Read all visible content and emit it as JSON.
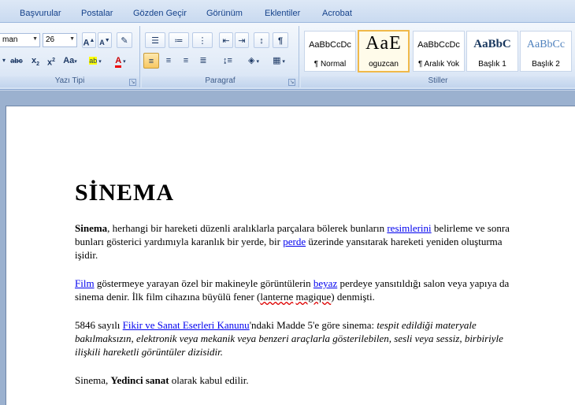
{
  "ribbon_tabs": [
    "Başvurular",
    "Postalar",
    "Gözden Geçir",
    "Görünüm",
    "Eklentiler",
    "Acrobat"
  ],
  "font_group": {
    "label": "Yazı Tipi",
    "font_name": "man",
    "font_size": "26",
    "grow_label": "A",
    "shrink_label": "A",
    "strike_label": "abc",
    "subscript_label": "x",
    "superscript_label": "x",
    "case_label": "Aa",
    "highlight_label": "ab",
    "font_color_label": "A"
  },
  "paragraph_group": {
    "label": "Paragraf"
  },
  "styles_group": {
    "label": "Stiller",
    "tiles": [
      {
        "sample": "AaBbCcDc",
        "name": "¶ Normal"
      },
      {
        "sample": "AaE",
        "name": "oguzcan"
      },
      {
        "sample": "AaBbCcDc",
        "name": "¶ Aralık Yok"
      },
      {
        "sample": "AaBbC",
        "name": "Başlık 1"
      },
      {
        "sample": "AaBbCc",
        "name": "Başlık 2"
      }
    ]
  },
  "document": {
    "title": "SİNEMA",
    "p1": {
      "bold": "Sinema",
      "t1": ", herhangi bir hareketi düzenli aralıklarla parçalara bölerek bunların ",
      "link1": "resimlerini",
      "t2": " belirleme ve sonra bunları gösterici yardımıyla karanlık bir yerde, bir ",
      "link2": "perde",
      "t3": " üzerinde yansıtarak hareketi yeniden oluşturma işidir."
    },
    "p2": {
      "link1": "Film",
      "t1": " göstermeye yarayan özel bir makineyle görüntülerin ",
      "link2": "beyaz",
      "t2": " perdeye yansıtıldığı salon veya yapıya da sinema denir. İlk film cihazına büyülü fener (",
      "squiggle1": "lanterne",
      "t3": " ",
      "squiggle2": "magique",
      "t4": ") denmişti."
    },
    "p3": {
      "t1": "5846 sayılı ",
      "link1": "Fikir ve Sanat Eserleri Kanunu",
      "t2": "'ndaki Madde 5'e göre sinema: ",
      "italic": "tespit edildiği materyale bakılmaksızın, elektronik veya mekanik veya benzeri araçlarla gösterilebilen, sesli veya sessiz, birbiriyle ilişkili hareketli görüntüler dizisidir."
    },
    "p4": {
      "t1": "Sinema, ",
      "bold": "Yedinci sanat",
      "t2": " olarak kabul edilir."
    }
  }
}
